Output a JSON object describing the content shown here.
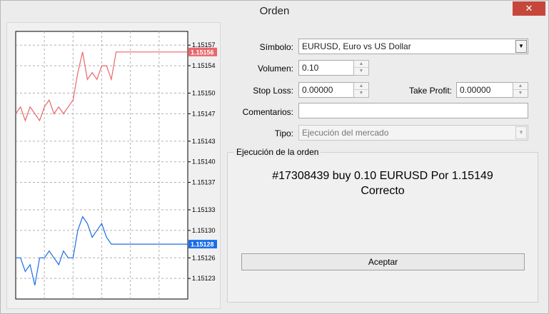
{
  "window": {
    "title": "Orden",
    "close_glyph": "✕"
  },
  "chart": {
    "price_labels": [
      "1.15157",
      "1.15154",
      "1.15150",
      "1.15147",
      "1.15143",
      "1.15140",
      "1.15137",
      "1.15133",
      "1.15130",
      "1.15126",
      "1.15123"
    ],
    "ask_label": "1.15156",
    "bid_label": "1.15128",
    "ask_color": "#e8666a",
    "bid_color": "#1a6ee8"
  },
  "chart_data": {
    "type": "line",
    "y_ticks": [
      1.15157,
      1.15154,
      1.1515,
      1.15147,
      1.15143,
      1.1514,
      1.15137,
      1.15133,
      1.1513,
      1.15126,
      1.15123
    ],
    "ylim": [
      1.1512,
      1.15159
    ],
    "series": [
      {
        "values": [
          1.15147,
          1.15148,
          1.15146,
          1.15148,
          1.15147,
          1.15146,
          1.15148,
          1.15149,
          1.15147,
          1.15148,
          1.15147,
          1.15148,
          1.15149,
          1.15153,
          1.15156,
          1.15152,
          1.15153,
          1.15152,
          1.15154,
          1.15154,
          1.15152,
          1.15156,
          1.15156,
          1.15156,
          1.15156,
          1.15156,
          1.15156,
          1.15156,
          1.15156,
          1.15156,
          1.15156,
          1.15156,
          1.15156,
          1.15156,
          1.15156,
          1.15156,
          1.15156
        ]
      },
      {
        "values": [
          1.15126,
          1.15126,
          1.15124,
          1.15125,
          1.15122,
          1.15126,
          1.15126,
          1.15127,
          1.15126,
          1.15125,
          1.15127,
          1.15126,
          1.15126,
          1.1513,
          1.15132,
          1.15131,
          1.15129,
          1.1513,
          1.15131,
          1.15129,
          1.15128,
          1.15128,
          1.15128,
          1.15128,
          1.15128,
          1.15128,
          1.15128,
          1.15128,
          1.15128,
          1.15128,
          1.15128,
          1.15128,
          1.15128,
          1.15128,
          1.15128,
          1.15128,
          1.15128
        ]
      }
    ],
    "grid": true,
    "legend": "none"
  },
  "form": {
    "symbol_label": "Símbolo:",
    "symbol_value": "EURUSD, Euro vs US Dollar",
    "volume_label": "Volumen:",
    "volume_value": "0.10",
    "stoploss_label": "Stop Loss:",
    "stoploss_value": "0.00000",
    "takeprofit_label": "Take Profit:",
    "takeprofit_value": "0.00000",
    "comments_label": "Comentarios:",
    "comments_value": "",
    "type_label": "Tipo:",
    "type_value": "Ejecución del mercado"
  },
  "execution": {
    "group_title": "Ejecución de la orden",
    "result_line1": "#17308439 buy 0.10 EURUSD Por 1.15149",
    "result_line2": "Correcto",
    "accept_label": "Aceptar"
  }
}
